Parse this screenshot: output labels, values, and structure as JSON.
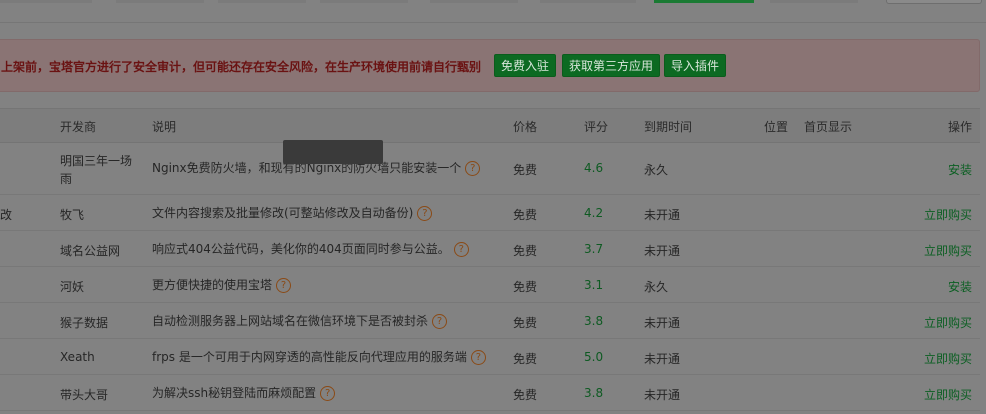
{
  "warning": {
    "text": "上架前，宝塔官方进行了安全审计，但可能还存在安全风险，在生产环境使用前请自行甄别",
    "buttons": [
      "免费入驻",
      "获取第三方应用",
      "导入插件"
    ]
  },
  "table": {
    "headers": {
      "developer": "开发商",
      "description": "说明",
      "price": "价格",
      "score": "评分",
      "expire": "到期时间",
      "position": "位置",
      "homepage": "首页显示",
      "action": "操作"
    },
    "rows": [
      {
        "name": "",
        "developer_line1": "明国三年一场",
        "developer_line2": "雨",
        "description": "Nginx免费防火墙，和现有的Nginx的防火墙只能安装一个",
        "price": "免费",
        "score": "4.6",
        "expire": "永久",
        "action": "安装"
      },
      {
        "name": "改",
        "developer": "牧飞",
        "description": "文件内容搜索及批量修改(可整站修改及自动备份)",
        "price": "免费",
        "score": "4.2",
        "expire": "未开通",
        "action": "立即购买"
      },
      {
        "name": "",
        "developer": "域名公益网",
        "description": "响应式404公益代码，美化你的404页面同时参与公益。",
        "price": "免费",
        "score": "3.7",
        "expire": "未开通",
        "action": "立即购买"
      },
      {
        "name": "",
        "developer": "河妖",
        "description": "更方便快捷的使用宝塔",
        "price": "免费",
        "score": "3.1",
        "expire": "永久",
        "action": "安装"
      },
      {
        "name": "",
        "developer": "猴子数据",
        "description": "自动检测服务器上网站域名在微信环境下是否被封杀",
        "price": "免费",
        "score": "3.8",
        "expire": "未开通",
        "action": "立即购买"
      },
      {
        "name": "",
        "developer": "Xeath",
        "description": "frps 是一个可用于内网穿透的高性能反向代理应用的服务端",
        "price": "免费",
        "score": "5.0",
        "expire": "未开通",
        "action": "立即购买"
      },
      {
        "name": "",
        "developer": "带头大哥",
        "description": "为解决ssh秘钥登陆而麻烦配置",
        "price": "免费",
        "score": "3.8",
        "expire": "未开通",
        "action": "立即购买"
      }
    ]
  },
  "icons": {
    "help": "?"
  }
}
